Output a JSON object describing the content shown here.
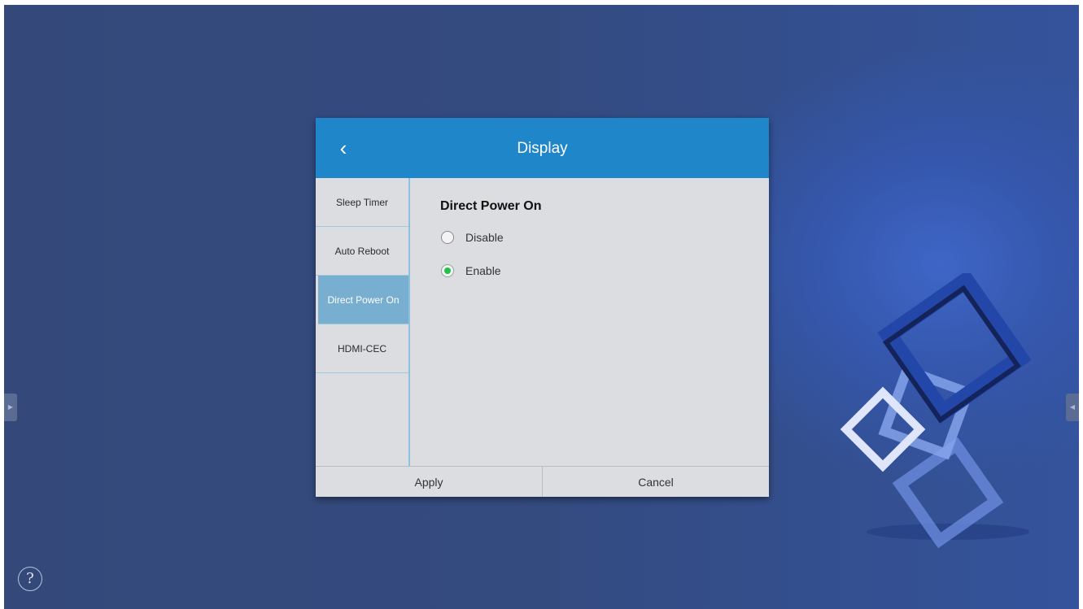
{
  "window": {
    "title": "Display"
  },
  "icons": {
    "back": "chevron-left-icon",
    "help": "question-circle-icon",
    "edge_left": "arrow-right-icon",
    "edge_right": "arrow-left-icon"
  },
  "help": {
    "symbol": "?"
  },
  "edge": {
    "left_symbol": "▶",
    "right_symbol": "◀"
  },
  "back": {
    "symbol": "‹"
  },
  "sidebar": {
    "items": [
      {
        "label": "Sleep Timer"
      },
      {
        "label": "Auto Reboot"
      },
      {
        "label": "Direct Power On"
      },
      {
        "label": "HDMI-CEC"
      }
    ],
    "active_index": 2
  },
  "content": {
    "title": "Direct Power On",
    "options": [
      {
        "label": "Disable",
        "checked": false
      },
      {
        "label": "Enable",
        "checked": true
      }
    ]
  },
  "footer": {
    "apply_label": "Apply",
    "cancel_label": "Cancel"
  },
  "colors": {
    "header": "#1e86c9",
    "active_tab": "#78aecf",
    "radio_checked": "#22c24a",
    "background": "#344b80"
  }
}
